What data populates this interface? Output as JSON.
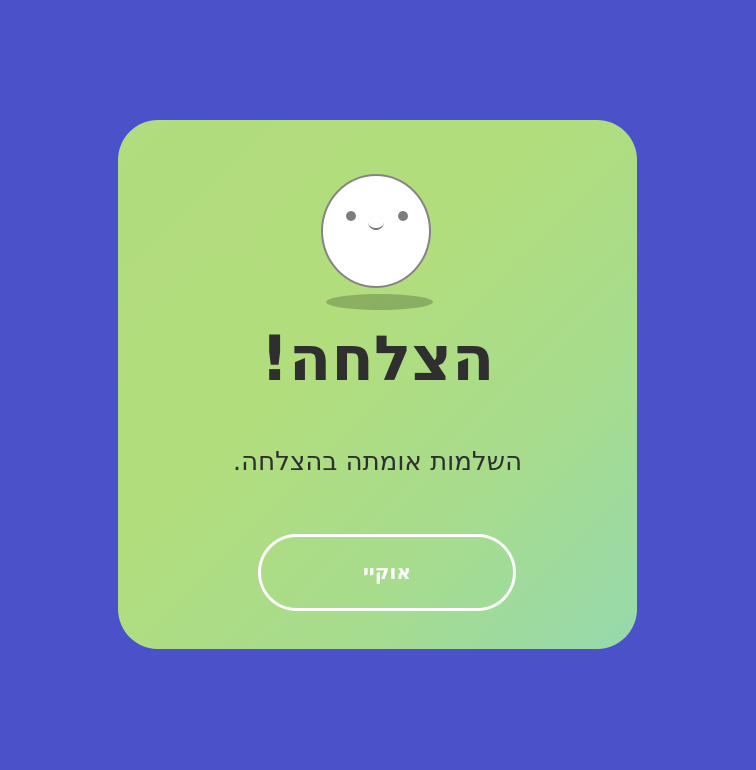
{
  "dialog": {
    "title": "הצלחה!",
    "message": "השלמות אומתה בהצלחה.",
    "ok_label": "אוקיי",
    "mascot_icon": "smiley-face-icon"
  },
  "colors": {
    "background": "#4b51c8",
    "card_gradient_start": "#b1dc7f",
    "card_gradient_end": "#96d9ad",
    "text": "#2f2f2f",
    "button_text": "#ffffff"
  }
}
